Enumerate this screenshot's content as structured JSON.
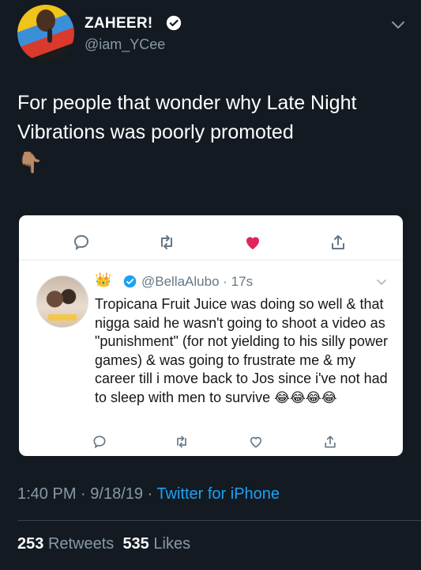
{
  "header": {
    "display_name": "ZAHEER!",
    "handle": "@iam_YCee"
  },
  "tweet": {
    "text": "For people that wonder why Late Night Vibrations was poorly promoted",
    "emoji": "👇🏽"
  },
  "embedded": {
    "handle": "@BellaAlubo",
    "time": "17s",
    "crown_emoji": "👑",
    "text": "Tropicana Fruit Juice was doing so well & that nigga said he wasn't going to shoot a video as \"punishment\" (for not yielding to his silly power games) & was going to frustrate me & my career till i move back to Jos since i've not had to sleep with men to survive",
    "laugh_emojis": "😂😂😂😂"
  },
  "meta": {
    "time": "1:40 PM",
    "date": "9/18/19",
    "source": "Twitter for iPhone",
    "separator": " · "
  },
  "stats": {
    "retweets_count": "253",
    "retweets_label": "Retweets",
    "likes_count": "535",
    "likes_label": "Likes"
  },
  "colors": {
    "background": "#131a22",
    "link": "#1da1f2",
    "muted": "#8899a6",
    "heart": "#e0245e"
  },
  "icons": [
    "verified-icon",
    "chevron-down-icon",
    "reply-icon",
    "retweet-icon",
    "heart-icon",
    "share-icon"
  ]
}
